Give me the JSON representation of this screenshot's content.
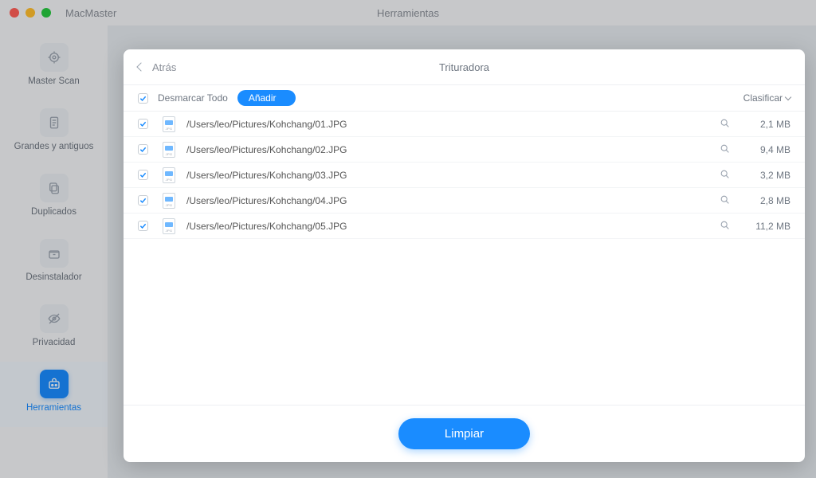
{
  "window": {
    "app_name": "MacMaster",
    "title": "Herramientas"
  },
  "sidebar": {
    "items": [
      {
        "id": "master-scan",
        "label": "Master Scan",
        "icon": "target-icon",
        "selected": false
      },
      {
        "id": "large-old",
        "label": "Grandes y antiguos",
        "icon": "document-icon",
        "selected": false
      },
      {
        "id": "duplicates",
        "label": "Duplicados",
        "icon": "copy-icon",
        "selected": false
      },
      {
        "id": "uninstaller",
        "label": "Desinstalador",
        "icon": "box-icon",
        "selected": false
      },
      {
        "id": "privacy",
        "label": "Privacidad",
        "icon": "eye-off-icon",
        "selected": false
      },
      {
        "id": "tools",
        "label": "Herramientas",
        "icon": "toolbox-icon",
        "selected": true
      }
    ]
  },
  "modal": {
    "back_label": "Atrás",
    "title": "Trituradora",
    "toolbar": {
      "deselect_all_label": "Desmarcar Todo",
      "master_checked": true,
      "add_label": "Añadir",
      "sort_label": "Clasificar"
    },
    "files": [
      {
        "checked": true,
        "path": "/Users/leo/Pictures/Kohchang/01.JPG",
        "size": "2,1 MB"
      },
      {
        "checked": true,
        "path": "/Users/leo/Pictures/Kohchang/02.JPG",
        "size": "9,4 MB"
      },
      {
        "checked": true,
        "path": "/Users/leo/Pictures/Kohchang/03.JPG",
        "size": "3,2 MB"
      },
      {
        "checked": true,
        "path": "/Users/leo/Pictures/Kohchang/04.JPG",
        "size": "2,8 MB"
      },
      {
        "checked": true,
        "path": "/Users/leo/Pictures/Kohchang/05.JPG",
        "size": "11,2 MB"
      }
    ],
    "footer": {
      "clean_label": "Limpiar"
    }
  },
  "colors": {
    "accent": "#1a8cff"
  }
}
